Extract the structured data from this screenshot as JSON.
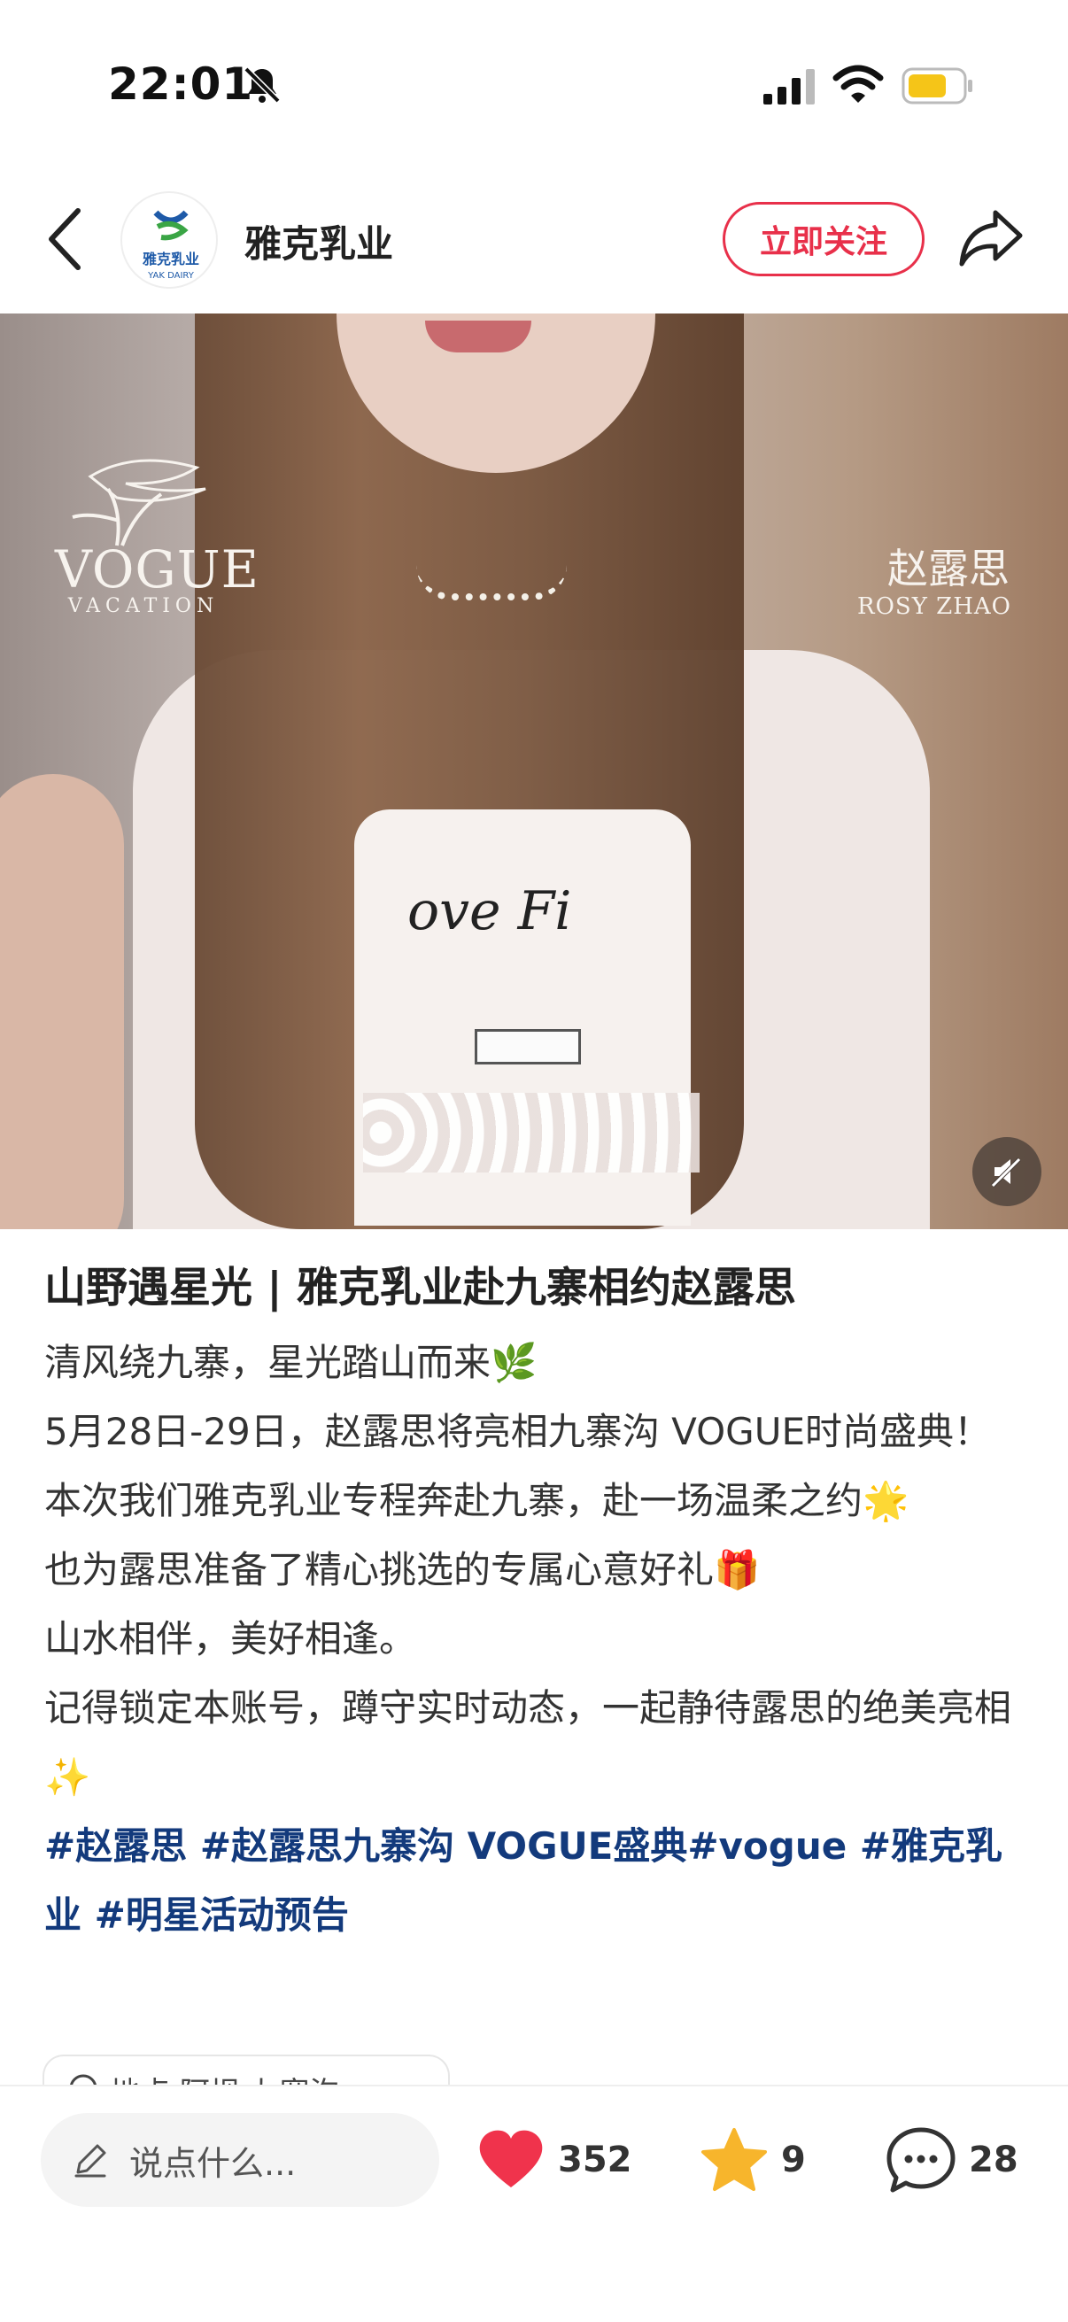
{
  "status_bar": {
    "time": "22:01",
    "icons": [
      "bell-mute-icon",
      "signal-icon",
      "wifi-icon",
      "battery-icon"
    ]
  },
  "header": {
    "back_icon": "chevron-left-icon",
    "avatar_text": "雅克乳业",
    "avatar_subtext": "YAK DAIRY",
    "account_name": "雅克乳业",
    "follow_label": "立即关注",
    "share_icon": "share-icon"
  },
  "hero": {
    "vogue_word": "VOGUE",
    "vogue_sub": "VACATION",
    "celebrity_cn": "赵露思",
    "celebrity_en": "ROSY ZHAO",
    "shirt_text": "ove Fi",
    "sound_icon": "speaker-muted-icon"
  },
  "post": {
    "title": "山野遇星光 | 雅克乳业赴九寨相约赵露思",
    "lines": [
      "清风绕九寨，星光踏山而来🌿",
      "5月28日-29日，赵露思将亮相九寨沟 VOGUE时尚盛典！",
      "本次我们雅克乳业专程奔赴九寨，赴一场温柔之约🌟",
      "也为露思准备了精心挑选的专属心意好礼🎁",
      "山水相伴，美好相逢。",
      "记得锁定本账号，蹲守实时动态，一起静待露思的绝美亮相✨"
    ],
    "tags": "#赵露思 #赵露思九寨沟 VOGUE盛典#vogue #雅克乳业 #明星活动预告",
    "location": "地点·阿坝·九寨沟"
  },
  "bottom_bar": {
    "comment_placeholder": "说点什么...",
    "likes": "352",
    "favorites": "9",
    "comments": "28"
  },
  "colors": {
    "accent_red": "#e8304a",
    "tag_blue": "#133a7c",
    "heart_red": "#f0334c",
    "star_yellow": "#f7b52c"
  }
}
